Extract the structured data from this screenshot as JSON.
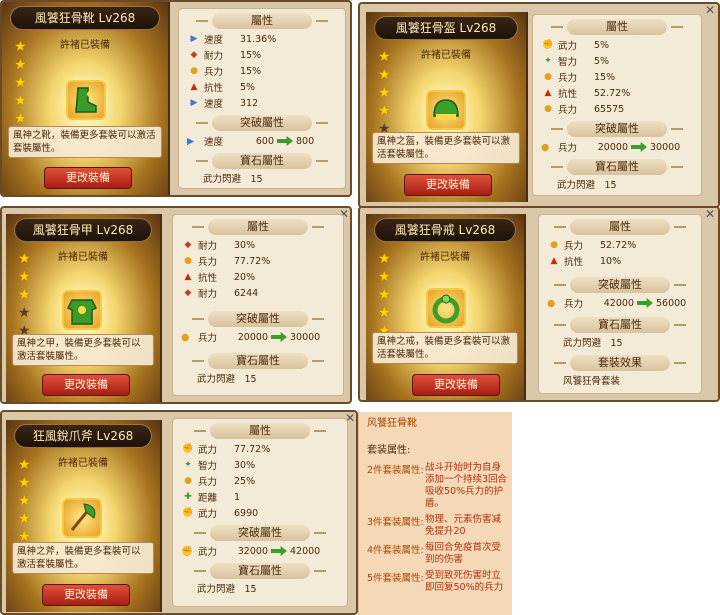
{
  "cards": [
    {
      "title": "風饕狂骨靴 Lv268",
      "owner": "許褚已裝備",
      "stars": [
        1,
        1,
        1,
        1,
        1
      ],
      "icon": "boots-icon",
      "desc": "風神之靴，裝備更多套裝可以激活套裝屬性。",
      "button": "更改裝備",
      "attr_header": "屬性",
      "attrs": [
        {
          "icon": "speed-icon",
          "label": "速度",
          "value": "31.36%"
        },
        {
          "icon": "endurance-icon",
          "label": "耐力",
          "value": "15%"
        },
        {
          "icon": "troops-icon",
          "label": "兵力",
          "value": "15%"
        },
        {
          "icon": "resist-icon",
          "label": "抗性",
          "value": "5%"
        },
        {
          "icon": "speed-icon",
          "label": "速度",
          "value": "312"
        }
      ],
      "break_header": "突破屬性",
      "break": {
        "label": "速度",
        "from": "600",
        "to": "800"
      },
      "gem_header": "寶石屬性",
      "gem_text": "武力閃避　15"
    },
    {
      "title": "風饕狂骨盔 Lv268",
      "owner": "許褚已裝備",
      "stars": [
        1,
        1,
        1,
        1,
        0
      ],
      "icon": "helmet-icon",
      "desc": "風神之盔，裝備更多套裝可以激活套裝屬性。",
      "button": "更改裝備",
      "attr_header": "屬性",
      "attrs": [
        {
          "icon": "strength-icon",
          "label": "武力",
          "value": "5%"
        },
        {
          "icon": "intellect-icon",
          "label": "智力",
          "value": "5%"
        },
        {
          "icon": "troops-icon",
          "label": "兵力",
          "value": "15%"
        },
        {
          "icon": "resist-icon",
          "label": "抗性",
          "value": "52.72%"
        },
        {
          "icon": "troops-icon",
          "label": "兵力",
          "value": "65575"
        }
      ],
      "break_header": "突破屬性",
      "break": {
        "label": "兵力",
        "from": "20000",
        "to": "30000"
      },
      "gem_header": "寶石屬性",
      "gem_text": "武力閃避　15"
    },
    {
      "title": "風饕狂骨甲 Lv268",
      "owner": "許褚已裝備",
      "stars": [
        1,
        1,
        1,
        0,
        0
      ],
      "icon": "armor-icon",
      "desc": "風神之甲，裝備更多套裝可以激活套裝屬性。",
      "button": "更改裝備",
      "attr_header": "屬性",
      "attrs": [
        {
          "icon": "endurance-icon",
          "label": "耐力",
          "value": "30%"
        },
        {
          "icon": "troops-icon",
          "label": "兵力",
          "value": "77.72%"
        },
        {
          "icon": "resist-icon",
          "label": "抗性",
          "value": "20%"
        },
        {
          "icon": "endurance-icon",
          "label": "耐力",
          "value": "6244"
        }
      ],
      "break_header": "突破屬性",
      "break": {
        "label": "兵力",
        "from": "20000",
        "to": "30000"
      },
      "gem_header": "寶石屬性",
      "gem_text": "武力閃避　15"
    },
    {
      "title": "風饕狂骨戒 Lv268",
      "owner": "許褚已裝備",
      "stars": [
        1,
        1,
        1,
        1,
        1
      ],
      "icon": "ring-icon",
      "desc": "風神之戒，裝備更多套裝可以激活套裝屬性。",
      "button": "更改裝備",
      "attr_header": "屬性",
      "attrs": [
        {
          "icon": "troops-icon",
          "label": "兵力",
          "value": "52.72%"
        },
        {
          "icon": "resist-icon",
          "label": "抗性",
          "value": "10%"
        }
      ],
      "break_header": "突破屬性",
      "break": {
        "label": "兵力",
        "from": "42000",
        "to": "56000"
      },
      "gem_header": "寶石屬性",
      "gem_text": "武力閃避　15",
      "set_header": "套裝效果",
      "set_text": "风饕狂骨套装"
    },
    {
      "title": "狂風銳爪斧 Lv268",
      "owner": "許褚已裝備",
      "stars": [
        1,
        1,
        1,
        1,
        1
      ],
      "icon": "axe-icon",
      "desc": "風神之斧，裝備更多套裝可以激活套裝屬性。",
      "button": "更改裝備",
      "attr_header": "屬性",
      "attrs": [
        {
          "icon": "strength-icon",
          "label": "武力",
          "value": "77.72%"
        },
        {
          "icon": "intellect-icon",
          "label": "智力",
          "value": "30%"
        },
        {
          "icon": "troops-icon",
          "label": "兵力",
          "value": "25%"
        },
        {
          "icon": "range-icon",
          "label": "距離",
          "value": "1"
        },
        {
          "icon": "strength-icon",
          "label": "武力",
          "value": "6990"
        }
      ],
      "break_header": "突破屬性",
      "break": {
        "label": "武力",
        "from": "32000",
        "to": "42000"
      },
      "gem_header": "寶石屬性",
      "gem_text": "武力閃避　15"
    }
  ],
  "setpanel": {
    "name": "风饕狂骨靴",
    "header": "套装属性:",
    "bonuses": [
      {
        "k": "2件套装属性:",
        "v": "战斗开始时为自身添加一个持续3回合吸收50%兵力的护盾。"
      },
      {
        "k": "3件套装属性:",
        "v": "物理、元素伤害减免提升20"
      },
      {
        "k": "4件套装属性:",
        "v": "每回合免疫首次受到的伤害"
      },
      {
        "k": "5件套装属性:",
        "v": "受到致死伤害时立即回复50%的兵力"
      }
    ]
  },
  "colors": {
    "accent": "#d9c7a8",
    "button": "#c0301e",
    "bonus_text": "#b03010"
  }
}
